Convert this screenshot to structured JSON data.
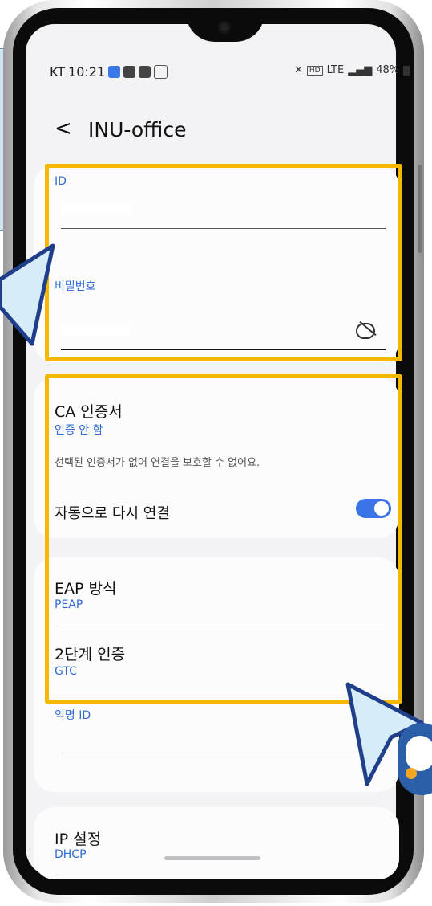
{
  "status_bar": {
    "carrier": "KT",
    "time": "10:21",
    "network": "LTE",
    "battery": "48%"
  },
  "header": {
    "back_label": "<",
    "title": "INU-office"
  },
  "fields": {
    "id": {
      "label": "ID",
      "value": ""
    },
    "password": {
      "label": "비밀번호",
      "value": ""
    }
  },
  "ca": {
    "title": "CA 인증서",
    "value": "인증 안 함",
    "warning": "선택된 인증서가 없어 연결을 보호할 수 없어요."
  },
  "auto_reconnect": {
    "label": "자동으로 다시 연결",
    "on": true
  },
  "eap": {
    "title": "EAP 방식",
    "value": "PEAP"
  },
  "phase2": {
    "title": "2단계 인증",
    "value": "GTC"
  },
  "anon": {
    "label": "익명 ID",
    "value": ""
  },
  "ip": {
    "title": "IP 설정",
    "value": "DHCP"
  },
  "colors": {
    "accent": "#2f6bd6",
    "highlight": "#f5b800",
    "toggle": "#3a74e7"
  }
}
